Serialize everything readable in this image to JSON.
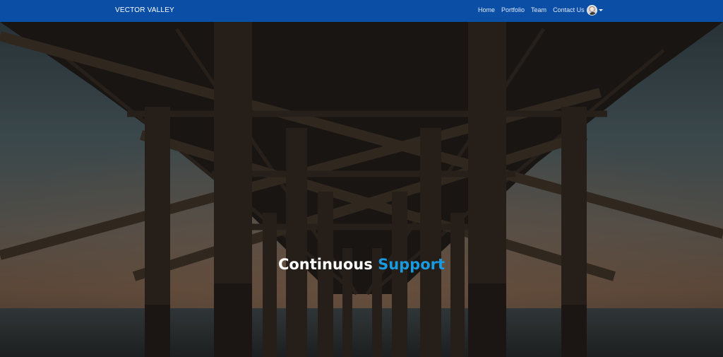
{
  "navbar": {
    "brand": "VECTOR VALLEY",
    "links": [
      "Home",
      "Portfolio",
      "Team",
      "Contact Us"
    ],
    "user_icon": "user-avatar-icon",
    "caret_icon": "chevron-down-icon"
  },
  "hero": {
    "headline_main": "Continuous",
    "headline_accent": "Support"
  },
  "colors": {
    "navbar": "#0a4ea6",
    "accent": "#1a9be0"
  }
}
